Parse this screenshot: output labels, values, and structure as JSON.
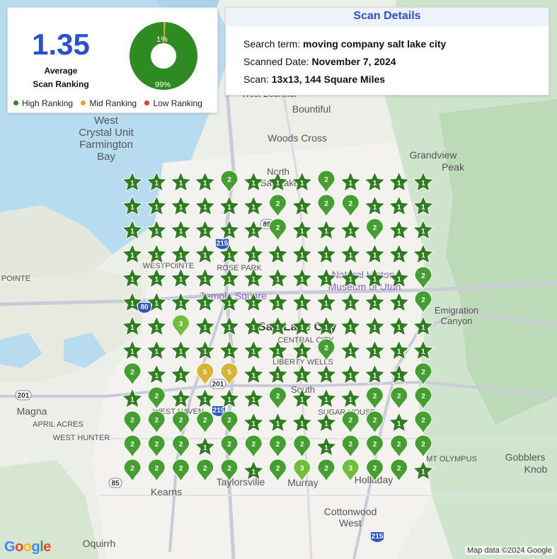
{
  "summary": {
    "average_value": "1.35",
    "average_label_1": "Average",
    "average_label_2": "Scan Ranking",
    "donut": {
      "high_percent": 99,
      "mid_percent": 1,
      "high_label": "99%",
      "mid_label": "1%"
    },
    "legend": [
      {
        "label": "High Ranking",
        "color": "#2e8b22"
      },
      {
        "label": "Mid Ranking",
        "color": "#e0a526"
      },
      {
        "label": "Low Ranking",
        "color": "#e53935"
      }
    ]
  },
  "details": {
    "title": "Scan Details",
    "search_label": "Search term:",
    "search_value": "moving company salt lake city",
    "date_label": "Scanned Date:",
    "date_value": "November 7, 2024",
    "scan_label": "Scan:",
    "scan_value": "13x13, 144 Square Miles"
  },
  "grid": {
    "rows": [
      "1 1 1 1 2 1 1 1 2 1 1 1 1",
      "1 1 1 1 1 1 2 1 2 2 1 1 1",
      "1 1 1 1 1 1 2 1 1 1 2 1 1",
      "1 1 1 1 1 1 1 1 1 1 1 1 1",
      "1 1 1 1 1 1 1 1 1 1 1 1 2",
      "1 1 1 1 1 1 1 1 1 1 1 1 2",
      "1 1 3 1 1 1 1 1 1 1 1 1 1",
      "1 1 1 1 1 1 1 1 2 1 1 1 1",
      "2 1 1 5 5 1 1 1 1 1 1 1 2",
      "1 2 1 1 1 1 2 1 1 1 2 2 2",
      "2 2 2 2 2 1 1 1 1 2 2 1 2",
      "2 2 2 1 2 2 2 2 1 2 2 2 2",
      "2 2 2 2 2 1 2 3 2 3 2 2 1"
    ]
  },
  "colors": {
    "rank1": "#2e7d1f",
    "rank2": "#43a02e",
    "rank3": "#6fbf3a",
    "rank5": "#d9b431"
  },
  "map_labels": {
    "west": "West",
    "crystal": "Crystal Unit",
    "farmington": "Farmington",
    "bay": "Bay",
    "bountiful": "Bountiful",
    "woods_cross": "Woods Cross",
    "west_bountiful": "West Bountiful",
    "grandview": "Grandview",
    "peak": "Peak",
    "north": "North",
    "salt_lake": "Salt Lake",
    "pointe": "POINTE",
    "westpointe": "WESTPOINTE",
    "rose_park": "ROSE PARK",
    "temple_square": "Temple Square",
    "natural_history": "Natural History",
    "museum": "Museum of Utah",
    "emigration": "Emigration",
    "canyon": "Canyon",
    "slc": "Salt Lake City",
    "central_city": "CENTRAL CITY",
    "liberty_wells": "LIBERTY WELLS",
    "south": "South",
    "sugar_house": "SUGAR HOUSE",
    "magna": "Magna",
    "april_acres": "APRIL ACRES",
    "west_hunter": "WEST HUNTER",
    "west_haven": "WEST HAVEN",
    "mt_olympus": "MT OLYMPUS",
    "gobblers": "Gobblers",
    "knob": "Knob",
    "kearns": "Kearns",
    "taylorsville": "Taylorsville",
    "murray": "Murray",
    "holladay": "Holladay",
    "cottonwood": "Cottonwood",
    "west2": "West",
    "oquirrh": "Oquirrh",
    "r215": "215",
    "r80": "80",
    "r201": "201",
    "r85": "85",
    "r89": "89"
  },
  "footer": {
    "google": "Google",
    "attribution": "Map data ©2024 Google"
  }
}
